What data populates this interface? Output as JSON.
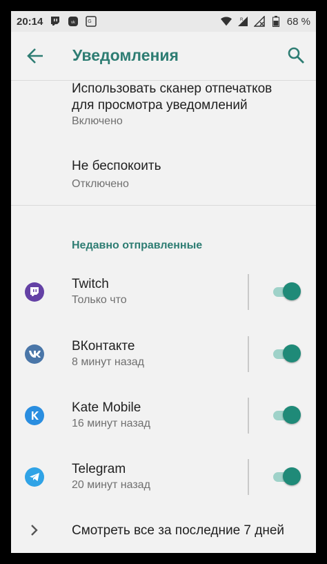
{
  "statusbar": {
    "time": "20:14",
    "battery": "68 %"
  },
  "appbar": {
    "title": "Уведомления"
  },
  "settings": [
    {
      "title_line1": "Использовать сканер отпечатков",
      "title_line2": "для просмотра уведомлений",
      "subtitle": "Включено"
    },
    {
      "title": "Не беспокоить",
      "subtitle": "Отключено"
    }
  ],
  "recent": {
    "header": "Недавно отправленные",
    "apps": [
      {
        "name": "Twitch",
        "time": "Только что",
        "icon": "twitch-icon",
        "color": "#6441a5",
        "enabled": true
      },
      {
        "name": "ВКонтакте",
        "time": "8 минут назад",
        "icon": "vk-icon",
        "color": "#4a76a8",
        "enabled": true
      },
      {
        "name": "Kate Mobile",
        "time": "16 минут назад",
        "icon": "kate-mobile-icon",
        "color": "#2a8ee0",
        "enabled": true
      },
      {
        "name": "Telegram",
        "time": "20 минут назад",
        "icon": "telegram-icon",
        "color": "#30a3e6",
        "enabled": true
      }
    ],
    "see_all": "Смотреть все за последние 7 дней"
  },
  "colors": {
    "accent": "#2e7d73",
    "toggle_thumb": "#1f8a78",
    "toggle_track": "#9fd2c9"
  }
}
